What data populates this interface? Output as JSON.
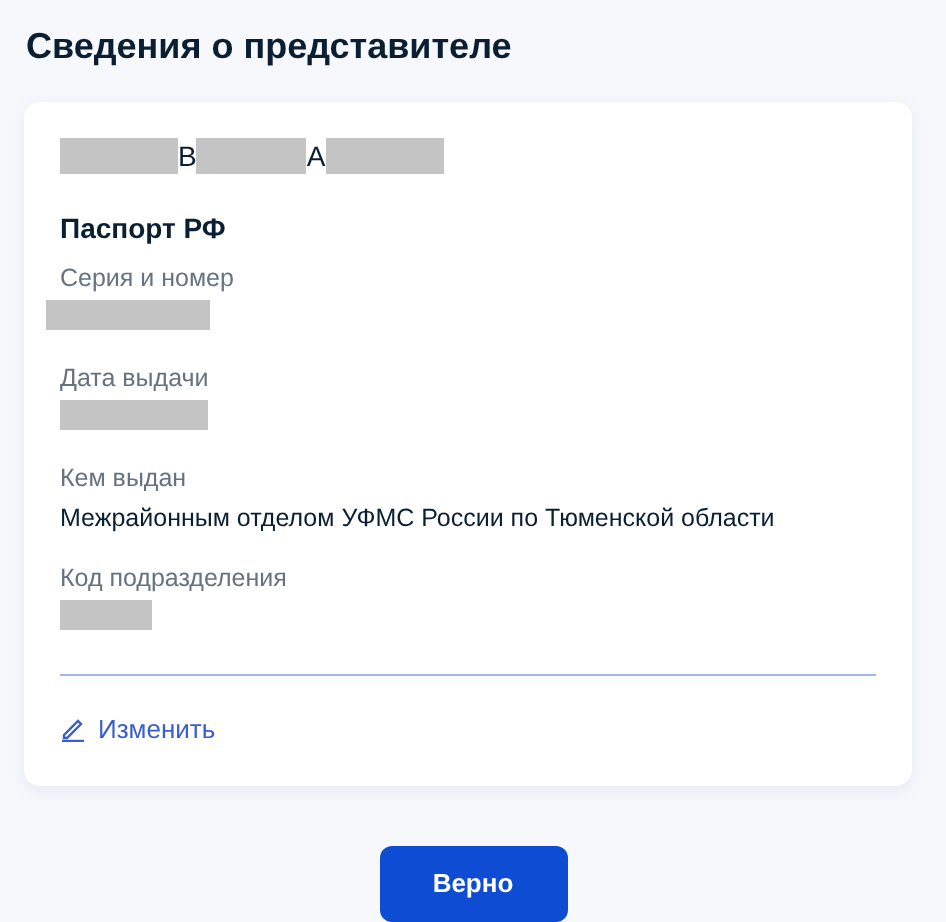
{
  "page": {
    "title": "Сведения о представителе"
  },
  "card": {
    "name_line": [
      {
        "kind": "redacted"
      },
      {
        "kind": "text",
        "text": "В"
      },
      {
        "kind": "redacted"
      },
      {
        "kind": "text",
        "text": "А"
      },
      {
        "kind": "redacted"
      }
    ],
    "document_title": "Паспорт РФ",
    "fields": [
      {
        "label": "Серия и номер",
        "value": {
          "kind": "redacted"
        }
      },
      {
        "label": "Дата выдачи",
        "value": {
          "kind": "redacted"
        }
      },
      {
        "label": "Кем выдан",
        "value": {
          "kind": "text",
          "text": "Межрайонным отделом УФМС России по Тюменской области"
        }
      },
      {
        "label": "Код подразделения",
        "value": {
          "kind": "redacted"
        }
      }
    ],
    "edit_link": "Изменить"
  },
  "buttons": [
    "Верно"
  ]
}
